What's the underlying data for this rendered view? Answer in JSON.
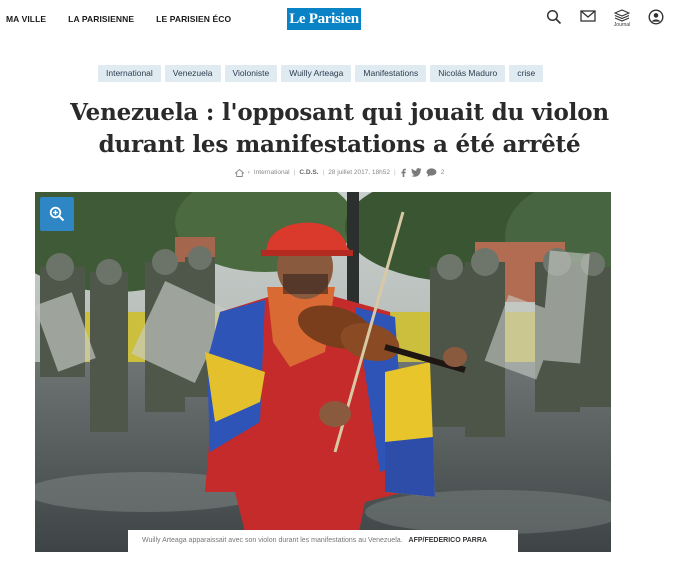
{
  "nav": {
    "items": [
      "MA VILLE",
      "LA PARISIENNE",
      "LE PARISIEN ÉCO"
    ]
  },
  "logo": {
    "text": "Le Parisien"
  },
  "header_icons": {
    "search": "search-icon",
    "mail": "mail-icon",
    "journal": "journal-icon",
    "journal_label": "Journal",
    "account": "account-icon"
  },
  "tags": [
    "International",
    "Venezuela",
    "Violoniste",
    "Wuilly Arteaga",
    "Manifestations",
    "Nicolás Maduro",
    "crise"
  ],
  "article": {
    "title_line1": "Venezuela : l'opposant qui jouait du violon",
    "title_line2": "durant les manifestations a été arrêté",
    "breadcrumb_home": "home-icon",
    "section": "International",
    "author": "C.D.S.",
    "date": "28 juillet 2017, 18h52",
    "comment_count": "2"
  },
  "image": {
    "caption": "Wuilly Arteaga apparaissait avec son violon durant les manifestations au Venezuela.",
    "credit": "AFP/FEDERICO PARRA"
  },
  "colors": {
    "brand": "#0a83c6",
    "tag_bg": "#dfeaf1",
    "zoom_button": "#2e86c4"
  }
}
